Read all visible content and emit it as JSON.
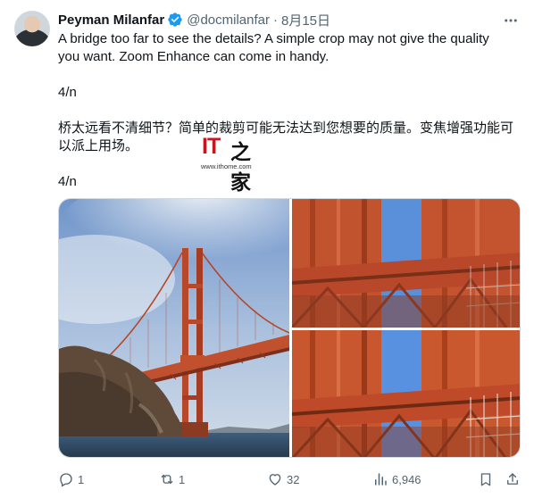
{
  "author": {
    "name": "Peyman Milanfar",
    "handle": "@docmilanfar",
    "separator": "·",
    "date": "8月15日"
  },
  "tweet": {
    "text_en": "A bridge too far to see the details? A simple crop may not give the quality you want. Zoom Enhance can come in handy.",
    "counter_1": "4/n",
    "text_zh": "桥太远看不清细节？简单的裁剪可能无法达到您想要的质量。变焦增强功能可以派上用场。",
    "counter_2": "4/n"
  },
  "watermark": {
    "logo_latin": "IT",
    "logo_cjk": "之家",
    "url": "www.ithome.com"
  },
  "actions": {
    "reply_count": "1",
    "retweet_count": "1",
    "like_count": "32",
    "views_count": "6,946"
  },
  "icons": {
    "verified": "verified-badge-icon",
    "more": "more-dots-icon",
    "reply": "reply-bubble-icon",
    "retweet": "retweet-icon",
    "like": "heart-icon",
    "views": "views-bar-chart-icon",
    "bookmark": "bookmark-icon",
    "share": "share-icon"
  },
  "colors": {
    "text_primary": "#0f1419",
    "text_secondary": "#536471",
    "verified_blue": "#1d9bf0",
    "bridge_orange": "#c1502e",
    "watermark_red": "#c8161d"
  }
}
